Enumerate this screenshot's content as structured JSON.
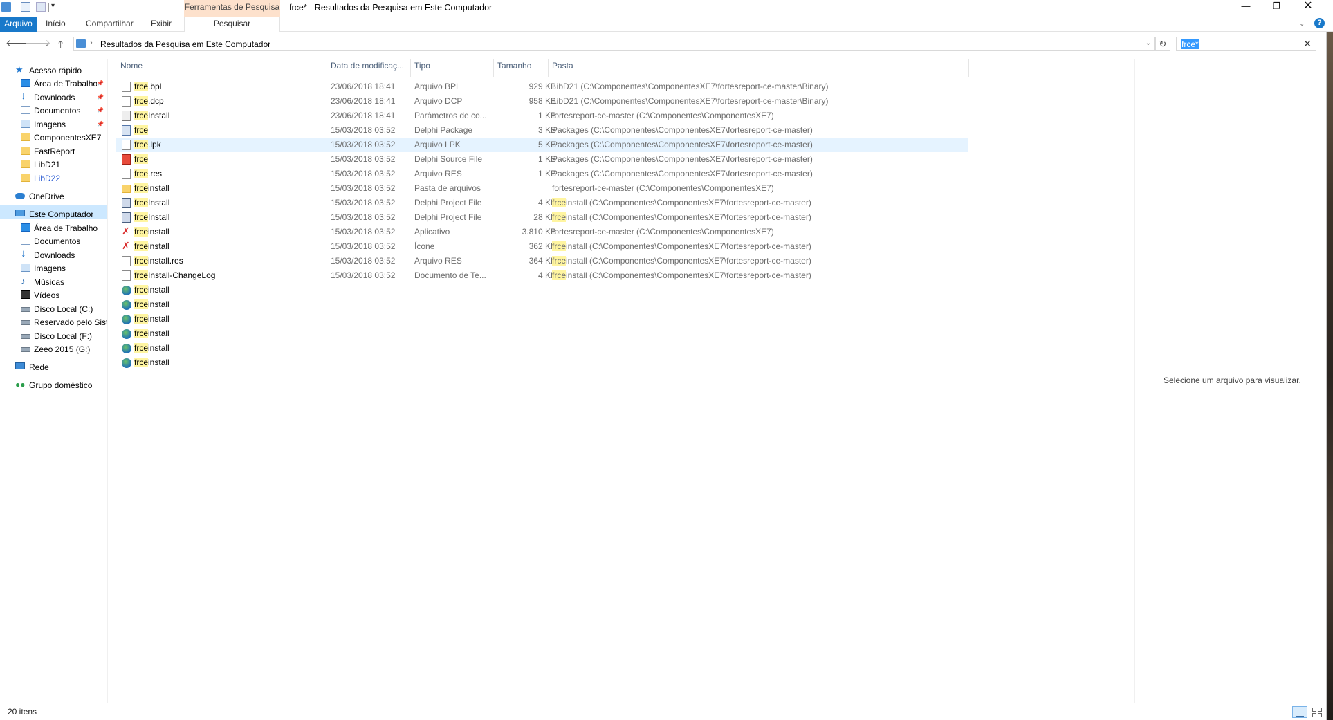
{
  "window": {
    "title": "frce* - Resultados da Pesquisa em Este Computador",
    "context_tab_group": "Ferramentas de Pesquisa",
    "controls": {
      "minimize": "—",
      "restore": "❐",
      "close": "✕"
    }
  },
  "quick_access_toolbar": {
    "dropdown": "▾"
  },
  "ribbon": {
    "tabs": [
      "Arquivo",
      "Início",
      "Compartilhar",
      "Exibir",
      "Pesquisar"
    ],
    "collapse": "⌄",
    "help": "?"
  },
  "address": {
    "back": "🡐",
    "forward": "🡒",
    "recent": "⌄",
    "up": "🡑",
    "chevron": "›",
    "path": "Resultados da Pesquisa em Este Computador",
    "dropdown": "⌄",
    "refresh": "↻"
  },
  "search": {
    "value": "frce*",
    "clear": "✕"
  },
  "nav": {
    "items": [
      {
        "label": "Acesso rápido",
        "icon": "star-icon",
        "level": 0,
        "pinned": false
      },
      {
        "label": "Área de Trabalho",
        "icon": "desktop-icon",
        "level": 1,
        "pinned": true
      },
      {
        "label": "Downloads",
        "icon": "download-icon",
        "level": 1,
        "pinned": true
      },
      {
        "label": "Documentos",
        "icon": "documents-icon",
        "level": 1,
        "pinned": true
      },
      {
        "label": "Imagens",
        "icon": "pictures-icon",
        "level": 1,
        "pinned": true
      },
      {
        "label": "ComponentesXE7",
        "icon": "folder-icon",
        "level": 1,
        "pinned": false
      },
      {
        "label": "FastReport",
        "icon": "folder-icon",
        "level": 1,
        "pinned": false
      },
      {
        "label": "LibD21",
        "icon": "folder-icon",
        "level": 1,
        "pinned": false
      },
      {
        "label": "LibD22",
        "icon": "folder-icon",
        "level": 1,
        "pinned": false
      },
      {
        "label": "OneDrive",
        "icon": "onedrive-icon",
        "level": 0,
        "pinned": false
      },
      {
        "label": "Este Computador",
        "icon": "computer-icon",
        "level": 0,
        "pinned": false
      },
      {
        "label": "Área de Trabalho",
        "icon": "desktop-icon",
        "level": 1,
        "pinned": false
      },
      {
        "label": "Documentos",
        "icon": "documents-icon",
        "level": 1,
        "pinned": false
      },
      {
        "label": "Downloads",
        "icon": "download-icon",
        "level": 1,
        "pinned": false
      },
      {
        "label": "Imagens",
        "icon": "pictures-icon",
        "level": 1,
        "pinned": false
      },
      {
        "label": "Músicas",
        "icon": "music-icon",
        "level": 1,
        "pinned": false
      },
      {
        "label": "Vídeos",
        "icon": "videos-icon",
        "level": 1,
        "pinned": false
      },
      {
        "label": "Disco Local (C:)",
        "icon": "drive-icon",
        "level": 1,
        "pinned": false
      },
      {
        "label": "Reservado pelo Sistema",
        "icon": "drive-icon",
        "level": 1,
        "pinned": false
      },
      {
        "label": "Disco Local (F:)",
        "icon": "drive-icon",
        "level": 1,
        "pinned": false
      },
      {
        "label": "Zeeo 2015 (G:)",
        "icon": "drive-icon",
        "level": 1,
        "pinned": false
      },
      {
        "label": "Rede",
        "icon": "network-icon",
        "level": 0,
        "pinned": false
      },
      {
        "label": "Grupo doméstico",
        "icon": "homegroup-icon",
        "level": 0,
        "pinned": false
      }
    ],
    "pin_glyph": "📌"
  },
  "filelist": {
    "columns": [
      "Nome",
      "Data de modificaç...",
      "Tipo",
      "Tamanho",
      "Pasta"
    ],
    "rows": [
      {
        "hl": "frce",
        "rest": ".bpl",
        "date": "23/06/2018 18:41",
        "type": "Arquivo BPL",
        "size": "929 KB",
        "path_hl": "",
        "path": "LibD21 (C:\\Componentes\\ComponentesXE7\\fortesreport-ce-master\\Binary)",
        "icon": "file"
      },
      {
        "hl": "frce",
        "rest": ".dcp",
        "date": "23/06/2018 18:41",
        "type": "Arquivo DCP",
        "size": "958 KB",
        "path_hl": "",
        "path": "LibD21 (C:\\Componentes\\ComponentesXE7\\fortesreport-ce-master\\Binary)",
        "icon": "file"
      },
      {
        "hl": "frce",
        "rest": "Install",
        "date": "23/06/2018 18:41",
        "type": "Parâmetros de co...",
        "size": "1 KB",
        "path_hl": "",
        "path": "fortesreport-ce-master (C:\\Componentes\\ComponentesXE7)",
        "icon": "params"
      },
      {
        "hl": "frce",
        "rest": "",
        "date": "15/03/2018 03:52",
        "type": "Delphi Package",
        "size": "3 KB",
        "path_hl": "",
        "path": "Packages (C:\\Componentes\\ComponentesXE7\\fortesreport-ce-master)",
        "icon": "pkg"
      },
      {
        "hl": "frce",
        "rest": ".lpk",
        "date": "15/03/2018 03:52",
        "type": "Arquivo LPK",
        "size": "5 KB",
        "path_hl": "",
        "path": "Packages (C:\\Componentes\\ComponentesXE7\\fortesreport-ce-master)",
        "icon": "file",
        "selected": true
      },
      {
        "hl": "frce",
        "rest": "",
        "date": "15/03/2018 03:52",
        "type": "Delphi Source File",
        "size": "1 KB",
        "path_hl": "",
        "path": "Packages (C:\\Componentes\\ComponentesXE7\\fortesreport-ce-master)",
        "icon": "source"
      },
      {
        "hl": "frce",
        "rest": ".res",
        "date": "15/03/2018 03:52",
        "type": "Arquivo RES",
        "size": "1 KB",
        "path_hl": "",
        "path": "Packages (C:\\Componentes\\ComponentesXE7\\fortesreport-ce-master)",
        "icon": "file"
      },
      {
        "hl": "frce",
        "rest": "install",
        "date": "15/03/2018 03:52",
        "type": "Pasta de arquivos",
        "size": "",
        "path_hl": "",
        "path": "fortesreport-ce-master (C:\\Componentes\\ComponentesXE7)",
        "icon": "folder"
      },
      {
        "hl": "frce",
        "rest": "Install",
        "date": "15/03/2018 03:52",
        "type": "Delphi Project File",
        "size": "4 KB",
        "path_hl": "frce",
        "path": "install (C:\\Componentes\\ComponentesXE7\\fortesreport-ce-master)",
        "icon": "proj"
      },
      {
        "hl": "frce",
        "rest": "Install",
        "date": "15/03/2018 03:52",
        "type": "Delphi Project File",
        "size": "28 KB",
        "path_hl": "frce",
        "path": "install (C:\\Componentes\\ComponentesXE7\\fortesreport-ce-master)",
        "icon": "proj"
      },
      {
        "hl": "frce",
        "rest": "install",
        "date": "15/03/2018 03:52",
        "type": "Aplicativo",
        "size": "3.810 KB",
        "path_hl": "",
        "path": "fortesreport-ce-master (C:\\Componentes\\ComponentesXE7)",
        "icon": "app"
      },
      {
        "hl": "frce",
        "rest": "install",
        "date": "15/03/2018 03:52",
        "type": "Ícone",
        "size": "362 KB",
        "path_hl": "frce",
        "path": "install (C:\\Componentes\\ComponentesXE7\\fortesreport-ce-master)",
        "icon": "app"
      },
      {
        "hl": "frce",
        "rest": "install.res",
        "date": "15/03/2018 03:52",
        "type": "Arquivo RES",
        "size": "364 KB",
        "path_hl": "frce",
        "path": "install (C:\\Componentes\\ComponentesXE7\\fortesreport-ce-master)",
        "icon": "file"
      },
      {
        "hl": "frce",
        "rest": "Install-ChangeLog",
        "date": "15/03/2018 03:52",
        "type": "Documento de Te...",
        "size": "4 KB",
        "path_hl": "frce",
        "path": "install (C:\\Componentes\\ComponentesXE7\\fortesreport-ce-master)",
        "icon": "file"
      },
      {
        "hl": "frce",
        "rest": "install",
        "date": "",
        "type": "",
        "size": "",
        "path_hl": "",
        "path": "",
        "icon": "globe"
      },
      {
        "hl": "frce",
        "rest": "install",
        "date": "",
        "type": "",
        "size": "",
        "path_hl": "",
        "path": "",
        "icon": "globe"
      },
      {
        "hl": "frce",
        "rest": "install",
        "date": "",
        "type": "",
        "size": "",
        "path_hl": "",
        "path": "",
        "icon": "globe"
      },
      {
        "hl": "frce",
        "rest": "install",
        "date": "",
        "type": "",
        "size": "",
        "path_hl": "",
        "path": "",
        "icon": "globe"
      },
      {
        "hl": "frce",
        "rest": "install",
        "date": "",
        "type": "",
        "size": "",
        "path_hl": "",
        "path": "",
        "icon": "globe"
      },
      {
        "hl": "frce",
        "rest": "install",
        "date": "",
        "type": "",
        "size": "",
        "path_hl": "",
        "path": "",
        "icon": "globe"
      }
    ]
  },
  "preview": {
    "text": "Selecione um arquivo para visualizar."
  },
  "status": {
    "count": "20 itens"
  },
  "colors": {
    "accent": "#1979ca",
    "highlight": "#fff5a0",
    "selected_row": "#e5f3ff",
    "context_tab": "#fde1cc"
  }
}
